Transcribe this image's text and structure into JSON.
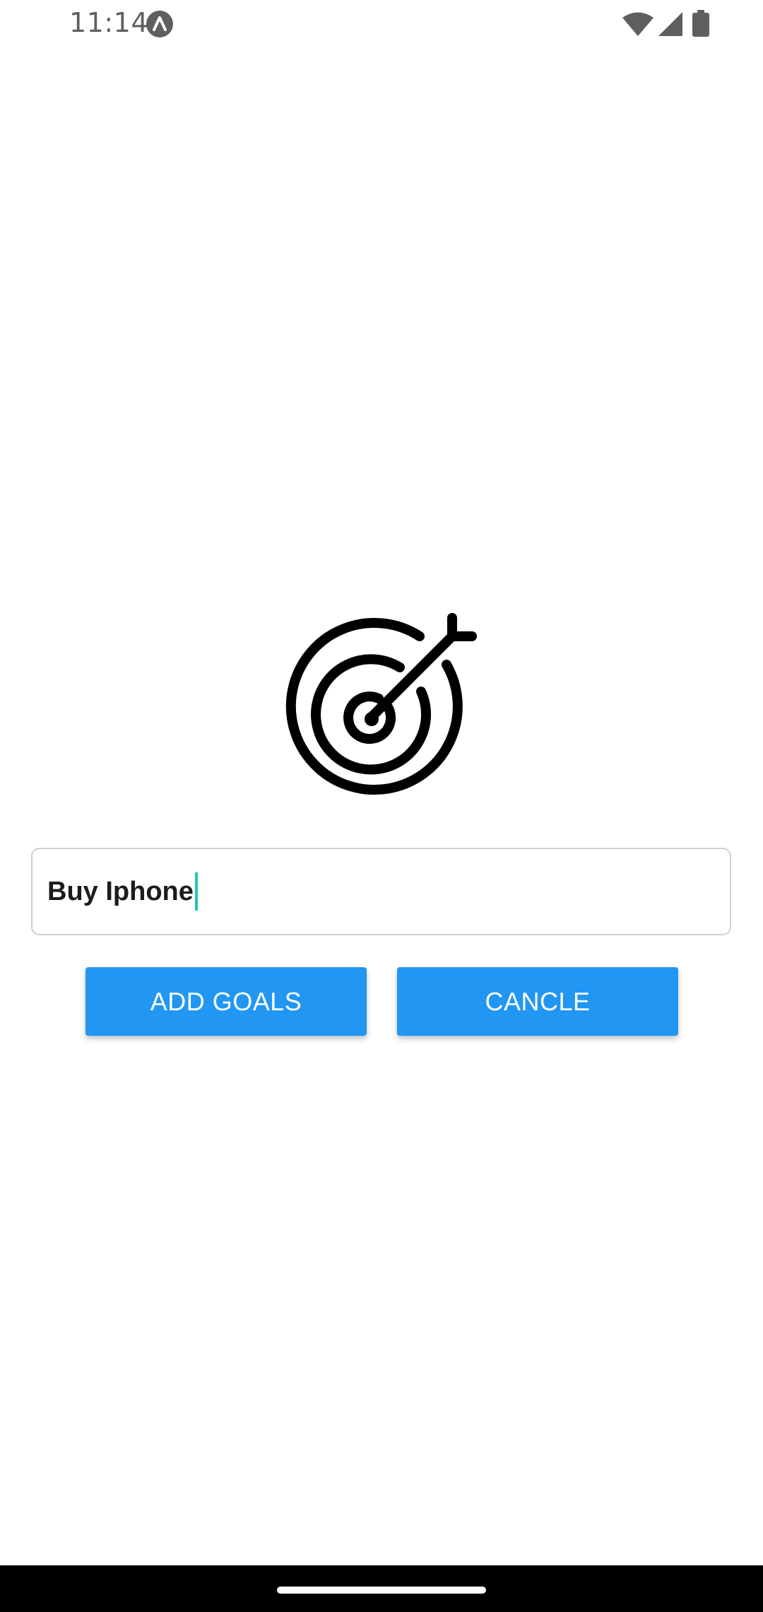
{
  "status_bar": {
    "time": "11:14",
    "app_icon": "expo-icon",
    "wifi_icon": "wifi-icon",
    "signal_icon": "cell-signal-icon",
    "battery_icon": "battery-icon"
  },
  "hero": {
    "icon": "target-icon"
  },
  "goal_input": {
    "value": "Buy Iphone"
  },
  "buttons": {
    "add_label": "ADD GOALS",
    "cancel_label": "CANCLE"
  },
  "colors": {
    "button_bg": "#2196f3",
    "button_text": "#ffffff",
    "caret": "#26c6b8",
    "input_border": "#cfcfcf"
  }
}
